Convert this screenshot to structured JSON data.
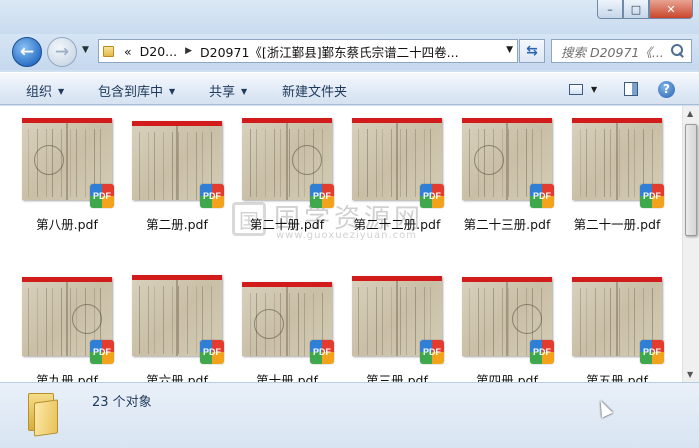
{
  "window": {
    "min_label": "–",
    "max_label": "□",
    "close_label": "✕"
  },
  "nav": {
    "back_icon": "←",
    "forward_icon": "→",
    "dropdown_icon": "▼"
  },
  "address": {
    "overflow": "«",
    "crumbs": [
      "D20...",
      "D20971《[浙江鄞县]鄞东蔡氏宗谱二十四卷..."
    ],
    "separator": "▶",
    "dropdown_icon": "▼",
    "refresh_icon": "⇆"
  },
  "search": {
    "placeholder": "搜索 D20971《..."
  },
  "toolbar": {
    "organize": "组织",
    "include_in_library": "包含到库中",
    "share": "共享",
    "new_folder": "新建文件夹",
    "dropdown_arrow": "▼",
    "help": "?"
  },
  "files": [
    {
      "name": "第八册.pdf"
    },
    {
      "name": "第二册.pdf"
    },
    {
      "name": "第二十册.pdf"
    },
    {
      "name": "第二十二册.pdf"
    },
    {
      "name": "第二十三册.pdf"
    },
    {
      "name": "第二十一册.pdf"
    },
    {
      "name": "第九册.pdf"
    },
    {
      "name": "第六册.pdf"
    },
    {
      "name": "第十册.pdf"
    },
    {
      "name": "第三册.pdf"
    },
    {
      "name": "第四册.pdf"
    },
    {
      "name": "第五册.pdf"
    }
  ],
  "pdf_badge": "PDF",
  "pdf_tag": "PDF",
  "watermark": {
    "logo": "国",
    "chinese": "国学资源网",
    "url": "www.guoxueziyuan.com"
  },
  "status": {
    "count_text": "23 个对象"
  },
  "colors": {
    "accent": "#2e74c9",
    "pdf_red": "#d21c1c"
  }
}
